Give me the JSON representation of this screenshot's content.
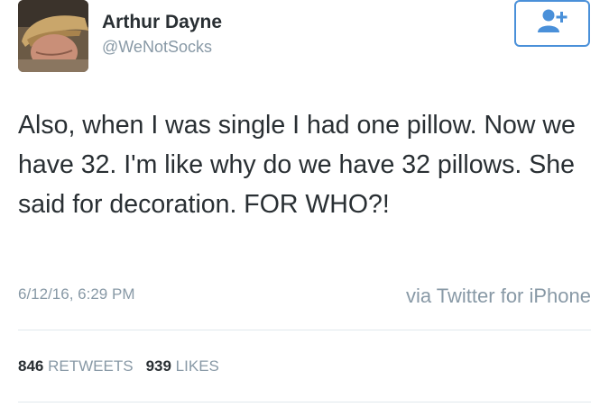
{
  "header": {
    "display_name": "Arthur Dayne",
    "handle": "@WeNotSocks",
    "follow_button_icon": "add-user-icon"
  },
  "tweet": {
    "text": "Also, when I was single I had one pillow. Now we have 32. I'm like why do we have 32 pillows. She said for decoration. FOR WHO?!",
    "timestamp": "6/12/16, 6:29 PM",
    "source": "via Twitter for iPhone"
  },
  "stats": {
    "retweets_count": "846",
    "retweets_label": "RETWEETS",
    "likes_count": "939",
    "likes_label": "LIKES"
  },
  "colors": {
    "accent": "#4a90d9",
    "text": "#292f33",
    "muted": "#8899a6",
    "divider": "#e1e8ed"
  }
}
